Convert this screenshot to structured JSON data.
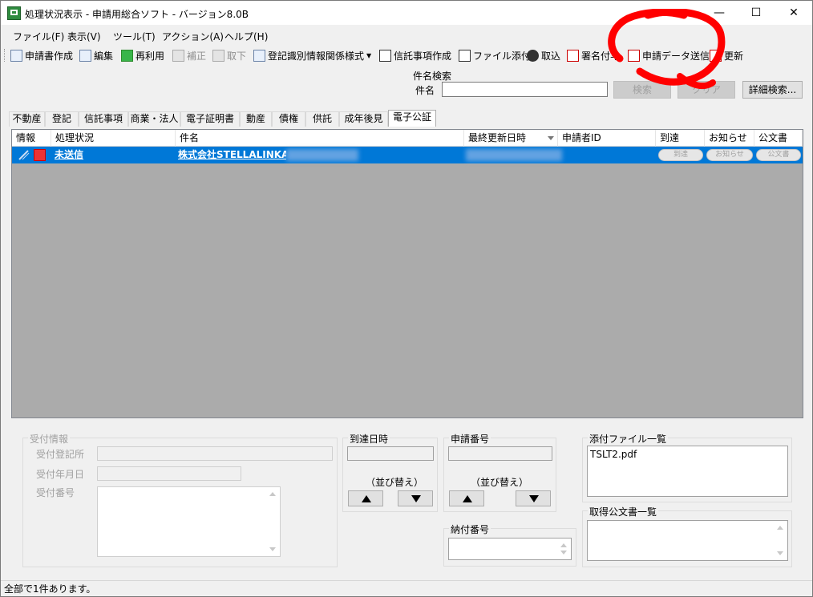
{
  "window": {
    "title": "処理状況表示 - 申請用総合ソフト - バージョン8.0B",
    "minimize_glyph": "—",
    "maximize_glyph": "☐",
    "close_glyph": "✕"
  },
  "menu": [
    "ファイル(F)",
    "表示(V)",
    "ツール(T)",
    "アクション(A)",
    "ヘルプ(H)"
  ],
  "toolbar": {
    "create_application": "申請書作成",
    "edit": "編集",
    "reuse": "再利用",
    "correct": "補正",
    "withdraw": "取下",
    "registry_form": "登記識別情報関係様式",
    "trust_create": "信託事項作成",
    "attach_file": "ファイル添付",
    "import": "取込",
    "sign": "署名付与",
    "send_data": "申請データ送信",
    "refresh": "更新"
  },
  "search": {
    "legend": "件名検索",
    "label": "件名",
    "value": "",
    "search_button": "検索",
    "clear_button": "クリア",
    "detail_button": "詳細検索..."
  },
  "tabs": [
    {
      "label": "不動産"
    },
    {
      "label": "登記"
    },
    {
      "label": "信託事項"
    },
    {
      "label": "商業・法人"
    },
    {
      "label": "電子証明書"
    },
    {
      "label": "動産"
    },
    {
      "label": "債権"
    },
    {
      "label": "供託"
    },
    {
      "label": "成年後見"
    },
    {
      "label": "電子公証",
      "active": true
    }
  ],
  "grid": {
    "headers": {
      "info": "情報",
      "status": "処理状況",
      "subject": "件名",
      "updated": "最終更新日時",
      "applicant_id": "申請者ID",
      "arrival": "到達",
      "notice": "お知らせ",
      "official_doc": "公文書"
    },
    "rows": [
      {
        "status": "未送信",
        "subject": "株式会社STELLALINKA",
        "applicant_id": "",
        "arrival_button": "到達",
        "notice_button": "お知らせ",
        "official_doc_button": "公文書"
      }
    ]
  },
  "receipt": {
    "legend": "受付情報",
    "office_label": "受付登記所",
    "date_label": "受付年月日",
    "number_label": "受付番号"
  },
  "arrival_time": {
    "legend": "到達日時",
    "sort_label": "（並び替え）"
  },
  "application_number": {
    "legend": "申請番号",
    "sort_label": "（並び替え）"
  },
  "payment_number": {
    "legend": "納付番号"
  },
  "attachments": {
    "legend": "添付ファイル一覧",
    "files": [
      "TSLT2.pdf"
    ]
  },
  "acquired_docs": {
    "legend": "取得公文書一覧"
  },
  "statusbar": {
    "text": "全部で1件あります。"
  },
  "colors": {
    "selection": "#0078d7",
    "grid_background": "#ababab",
    "annotation": "#ff0000"
  }
}
